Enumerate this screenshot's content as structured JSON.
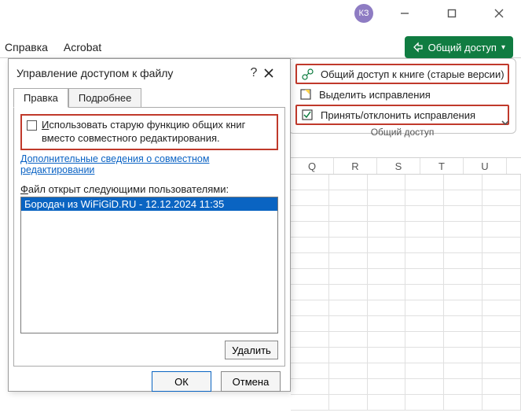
{
  "window": {
    "avatar_initials": "КЗ"
  },
  "ribbon": {
    "tabs": [
      "Справка",
      "Acrobat"
    ],
    "share_label": "Общий доступ",
    "panel": {
      "item1": "Общий доступ к книге (старые версии)",
      "item2": "Выделить исправления",
      "item3": "Принять/отклонить исправления",
      "group_label": "Общий доступ"
    }
  },
  "sheet": {
    "columns": [
      "Q",
      "R",
      "S",
      "T",
      "U"
    ]
  },
  "dialog": {
    "title": "Управление доступом к файлу",
    "tabs": {
      "edit": "Правка",
      "more": "Подробнее"
    },
    "checkbox_prefix": "И",
    "checkbox_rest": "спользовать старую функцию общих книг вместо совместного редактирования.",
    "coediting_link": "Дополнительные сведения о совместном редактировании",
    "users_prefix": "Ф",
    "users_rest": "айл открыт следующими пользователями:",
    "selected_user": "Бородач из WiFiGiD.RU - 12.12.2024 11:35",
    "delete_label": "Удалить",
    "ok_label": "ОК",
    "cancel_label": "Отмена"
  }
}
